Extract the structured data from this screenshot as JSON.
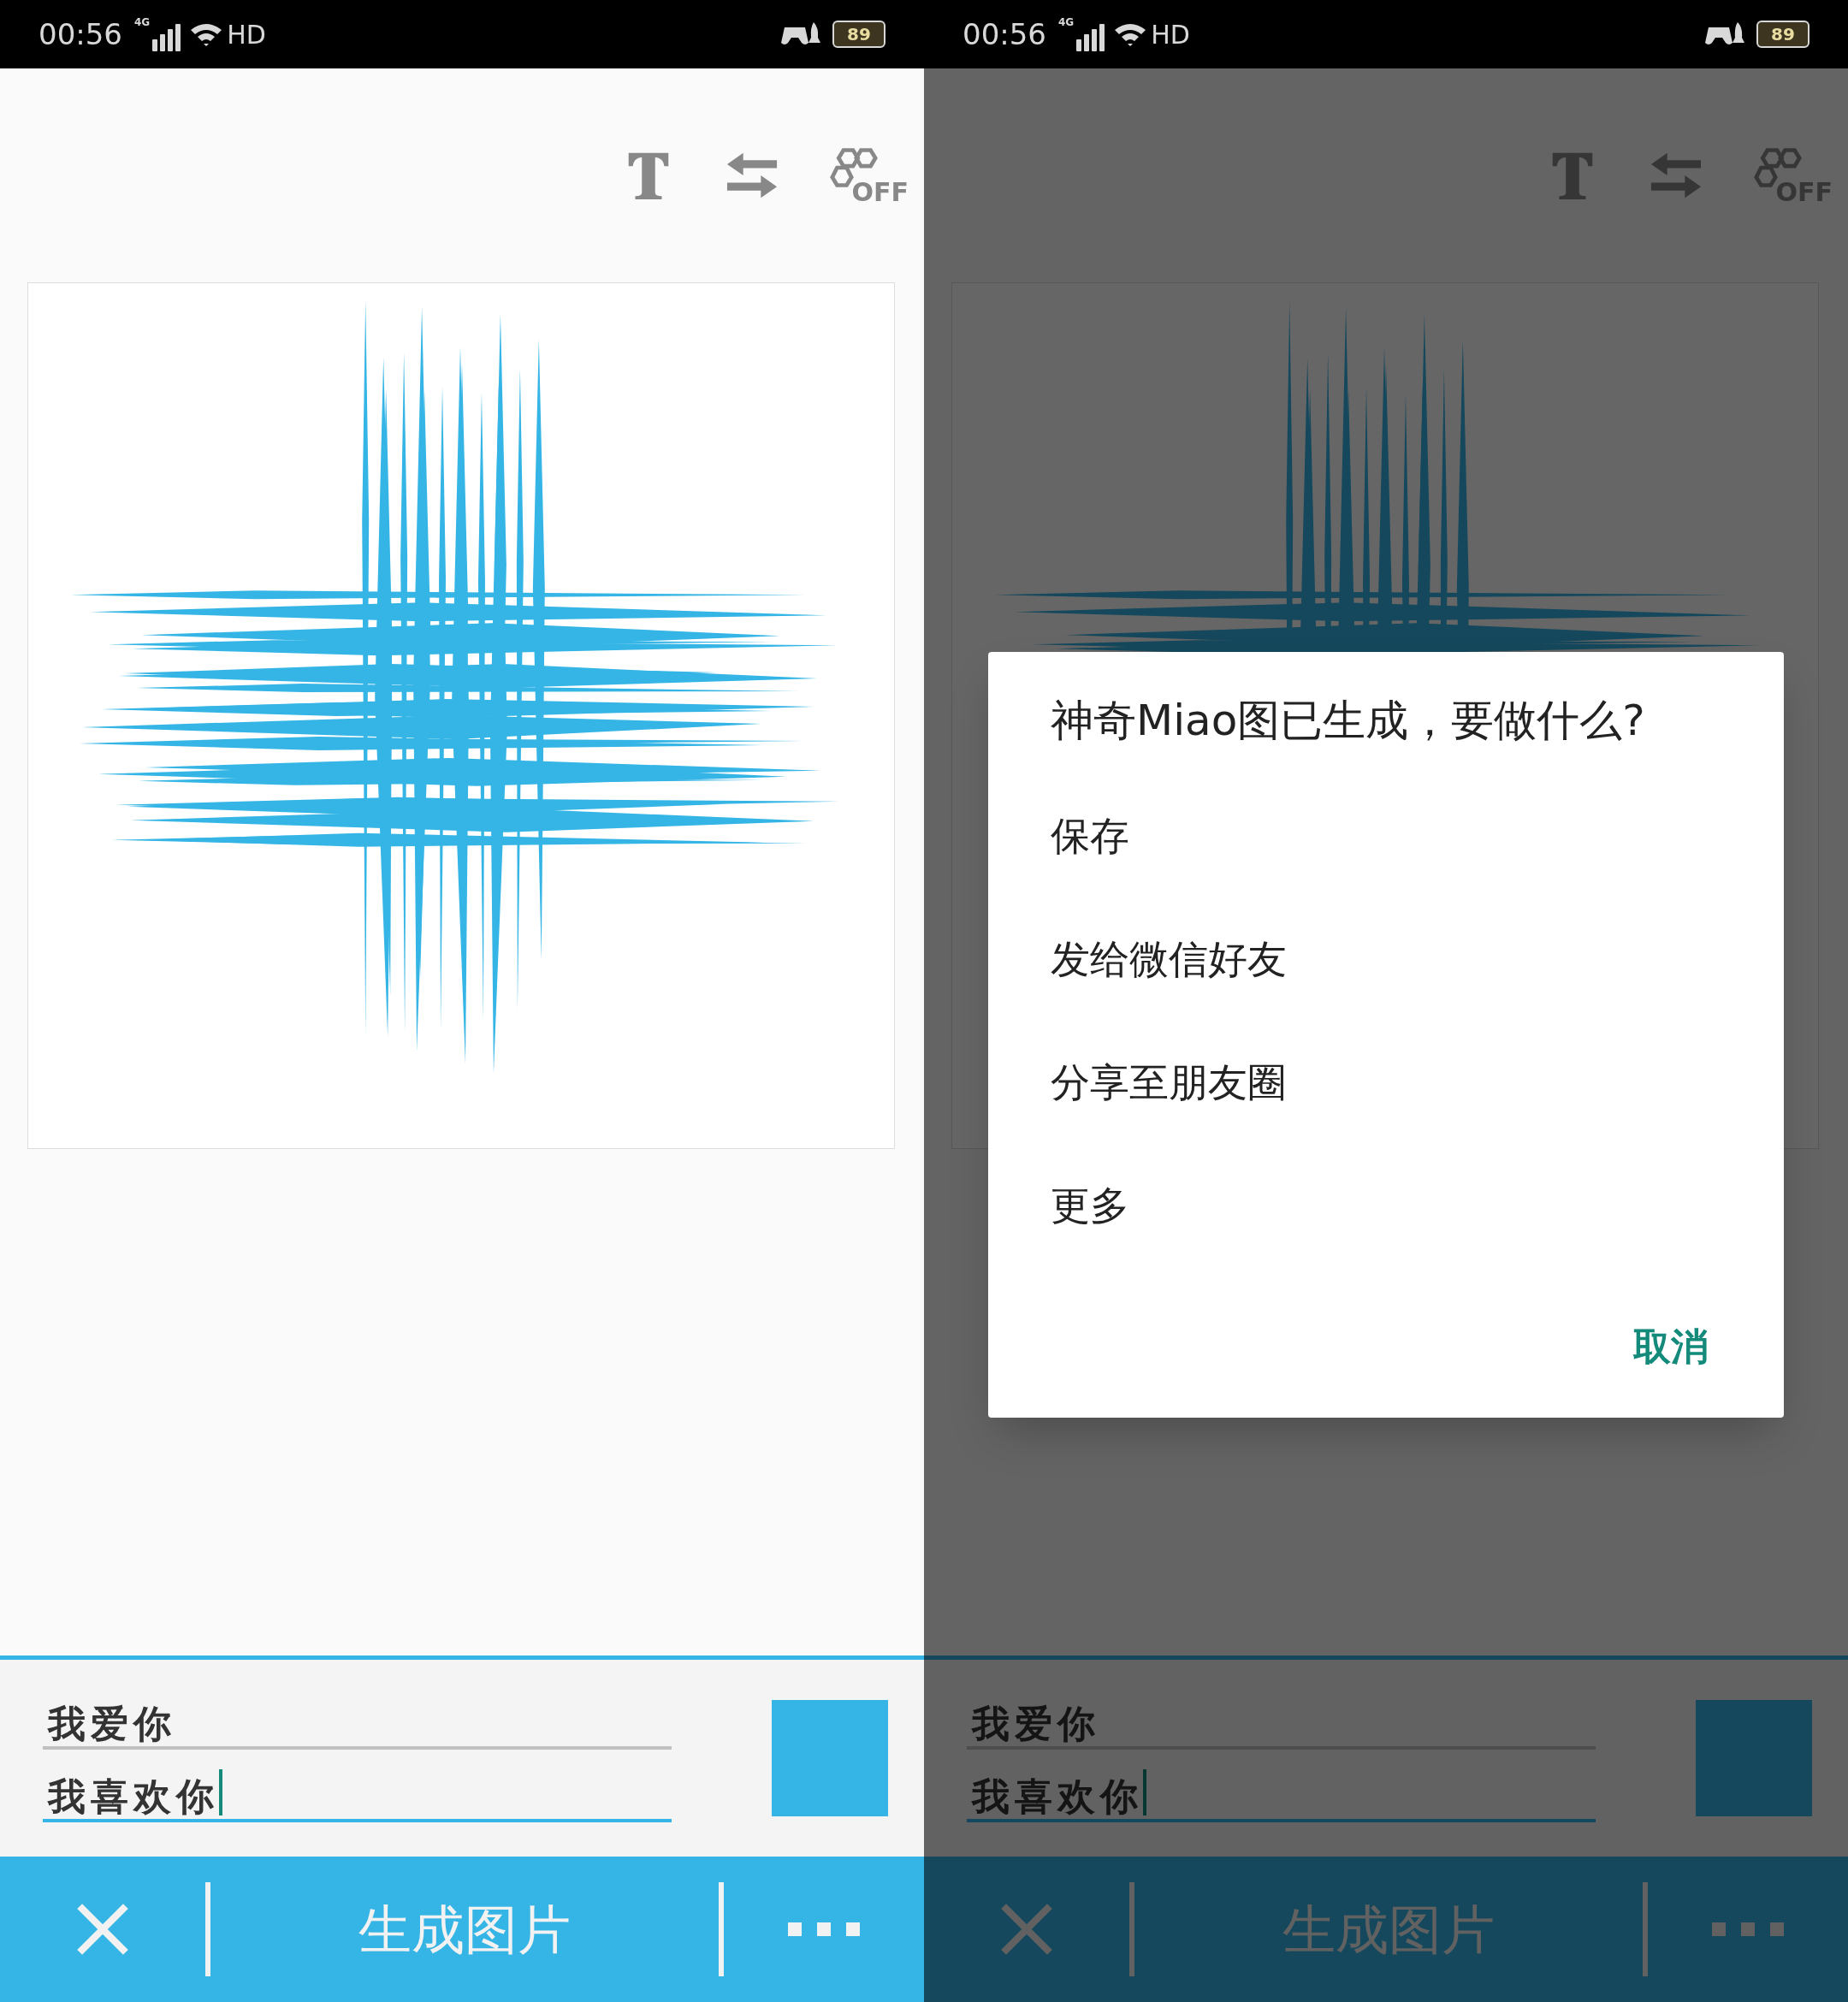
{
  "screens": [
    {
      "dimmed": false,
      "status_bar": {
        "time": "00:56",
        "network": "4G",
        "hd": "HD",
        "battery": "89"
      },
      "toolbar": {
        "off_label": "OFF"
      },
      "inputs": [
        {
          "value": "我爱你",
          "focused": false
        },
        {
          "value": "我喜欢你",
          "focused": true
        }
      ],
      "bottom_bar": {
        "action": "生成图片"
      }
    },
    {
      "dimmed": true,
      "status_bar": {
        "time": "00:56",
        "network": "4G",
        "hd": "HD",
        "battery": "89"
      },
      "toolbar": {
        "off_label": "OFF"
      },
      "inputs": [
        {
          "value": "我爱你",
          "focused": false
        },
        {
          "value": "我喜欢你",
          "focused": true
        }
      ],
      "bottom_bar": {
        "action": "生成图片"
      },
      "dialog": {
        "title": "神奇Miao图已生成，要做什么?",
        "options": [
          "保存",
          "发给微信好友",
          "分享至朋友圈",
          "更多"
        ],
        "cancel": "取消"
      }
    }
  ]
}
